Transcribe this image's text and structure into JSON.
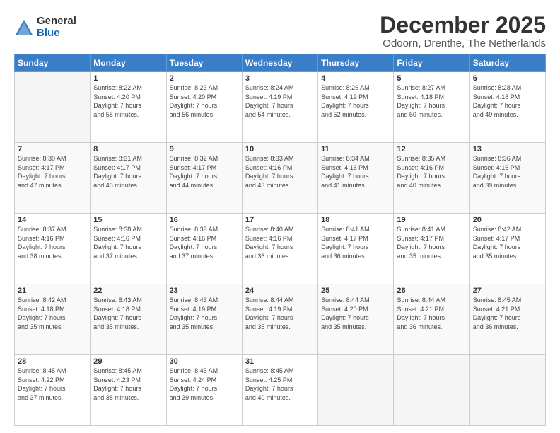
{
  "logo": {
    "general": "General",
    "blue": "Blue"
  },
  "header": {
    "title": "December 2025",
    "location": "Odoorn, Drenthe, The Netherlands"
  },
  "weekdays": [
    "Sunday",
    "Monday",
    "Tuesday",
    "Wednesday",
    "Thursday",
    "Friday",
    "Saturday"
  ],
  "weeks": [
    [
      {
        "day": "",
        "info": ""
      },
      {
        "day": "1",
        "info": "Sunrise: 8:22 AM\nSunset: 4:20 PM\nDaylight: 7 hours\nand 58 minutes."
      },
      {
        "day": "2",
        "info": "Sunrise: 8:23 AM\nSunset: 4:20 PM\nDaylight: 7 hours\nand 56 minutes."
      },
      {
        "day": "3",
        "info": "Sunrise: 8:24 AM\nSunset: 4:19 PM\nDaylight: 7 hours\nand 54 minutes."
      },
      {
        "day": "4",
        "info": "Sunrise: 8:26 AM\nSunset: 4:19 PM\nDaylight: 7 hours\nand 52 minutes."
      },
      {
        "day": "5",
        "info": "Sunrise: 8:27 AM\nSunset: 4:18 PM\nDaylight: 7 hours\nand 50 minutes."
      },
      {
        "day": "6",
        "info": "Sunrise: 8:28 AM\nSunset: 4:18 PM\nDaylight: 7 hours\nand 49 minutes."
      }
    ],
    [
      {
        "day": "7",
        "info": "Sunrise: 8:30 AM\nSunset: 4:17 PM\nDaylight: 7 hours\nand 47 minutes."
      },
      {
        "day": "8",
        "info": "Sunrise: 8:31 AM\nSunset: 4:17 PM\nDaylight: 7 hours\nand 45 minutes."
      },
      {
        "day": "9",
        "info": "Sunrise: 8:32 AM\nSunset: 4:17 PM\nDaylight: 7 hours\nand 44 minutes."
      },
      {
        "day": "10",
        "info": "Sunrise: 8:33 AM\nSunset: 4:16 PM\nDaylight: 7 hours\nand 43 minutes."
      },
      {
        "day": "11",
        "info": "Sunrise: 8:34 AM\nSunset: 4:16 PM\nDaylight: 7 hours\nand 41 minutes."
      },
      {
        "day": "12",
        "info": "Sunrise: 8:35 AM\nSunset: 4:16 PM\nDaylight: 7 hours\nand 40 minutes."
      },
      {
        "day": "13",
        "info": "Sunrise: 8:36 AM\nSunset: 4:16 PM\nDaylight: 7 hours\nand 39 minutes."
      }
    ],
    [
      {
        "day": "14",
        "info": "Sunrise: 8:37 AM\nSunset: 4:16 PM\nDaylight: 7 hours\nand 38 minutes."
      },
      {
        "day": "15",
        "info": "Sunrise: 8:38 AM\nSunset: 4:16 PM\nDaylight: 7 hours\nand 37 minutes."
      },
      {
        "day": "16",
        "info": "Sunrise: 8:39 AM\nSunset: 4:16 PM\nDaylight: 7 hours\nand 37 minutes."
      },
      {
        "day": "17",
        "info": "Sunrise: 8:40 AM\nSunset: 4:16 PM\nDaylight: 7 hours\nand 36 minutes."
      },
      {
        "day": "18",
        "info": "Sunrise: 8:41 AM\nSunset: 4:17 PM\nDaylight: 7 hours\nand 36 minutes."
      },
      {
        "day": "19",
        "info": "Sunrise: 8:41 AM\nSunset: 4:17 PM\nDaylight: 7 hours\nand 35 minutes."
      },
      {
        "day": "20",
        "info": "Sunrise: 8:42 AM\nSunset: 4:17 PM\nDaylight: 7 hours\nand 35 minutes."
      }
    ],
    [
      {
        "day": "21",
        "info": "Sunrise: 8:42 AM\nSunset: 4:18 PM\nDaylight: 7 hours\nand 35 minutes."
      },
      {
        "day": "22",
        "info": "Sunrise: 8:43 AM\nSunset: 4:18 PM\nDaylight: 7 hours\nand 35 minutes."
      },
      {
        "day": "23",
        "info": "Sunrise: 8:43 AM\nSunset: 4:19 PM\nDaylight: 7 hours\nand 35 minutes."
      },
      {
        "day": "24",
        "info": "Sunrise: 8:44 AM\nSunset: 4:19 PM\nDaylight: 7 hours\nand 35 minutes."
      },
      {
        "day": "25",
        "info": "Sunrise: 8:44 AM\nSunset: 4:20 PM\nDaylight: 7 hours\nand 35 minutes."
      },
      {
        "day": "26",
        "info": "Sunrise: 8:44 AM\nSunset: 4:21 PM\nDaylight: 7 hours\nand 36 minutes."
      },
      {
        "day": "27",
        "info": "Sunrise: 8:45 AM\nSunset: 4:21 PM\nDaylight: 7 hours\nand 36 minutes."
      }
    ],
    [
      {
        "day": "28",
        "info": "Sunrise: 8:45 AM\nSunset: 4:22 PM\nDaylight: 7 hours\nand 37 minutes."
      },
      {
        "day": "29",
        "info": "Sunrise: 8:45 AM\nSunset: 4:23 PM\nDaylight: 7 hours\nand 38 minutes."
      },
      {
        "day": "30",
        "info": "Sunrise: 8:45 AM\nSunset: 4:24 PM\nDaylight: 7 hours\nand 39 minutes."
      },
      {
        "day": "31",
        "info": "Sunrise: 8:45 AM\nSunset: 4:25 PM\nDaylight: 7 hours\nand 40 minutes."
      },
      {
        "day": "",
        "info": ""
      },
      {
        "day": "",
        "info": ""
      },
      {
        "day": "",
        "info": ""
      }
    ]
  ]
}
